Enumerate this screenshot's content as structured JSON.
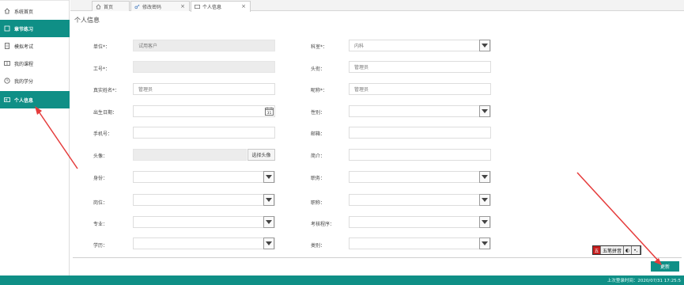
{
  "sidebar": {
    "items": [
      {
        "label": "系统首页",
        "active": false
      },
      {
        "label": "章节练习",
        "active": true
      },
      {
        "label": "模拟考试",
        "active": false
      },
      {
        "label": "我的课程",
        "active": false
      },
      {
        "label": "我的学分",
        "active": false
      },
      {
        "label": "个人信息",
        "active": true
      }
    ]
  },
  "tabs": [
    {
      "label": "首页"
    },
    {
      "label": "修改密码"
    },
    {
      "label": "个人信息"
    }
  ],
  "page": {
    "title": "个人信息"
  },
  "form": {
    "unit": {
      "label": "单位*：",
      "value": "试用客户"
    },
    "department": {
      "label": "科室*：",
      "value": "内科"
    },
    "emp_no": {
      "label": "工号*：",
      "value": ""
    },
    "title": {
      "label": "头衔：",
      "value": "管理员"
    },
    "real_name": {
      "label": "真实姓名*：",
      "value": "管理员"
    },
    "nickname": {
      "label": "昵称*：",
      "value": "管理员"
    },
    "birth": {
      "label": "出生日期：",
      "value": ""
    },
    "gender": {
      "label": "性别：",
      "value": ""
    },
    "phone": {
      "label": "手机号：",
      "value": ""
    },
    "email": {
      "label": "邮箱：",
      "value": ""
    },
    "avatar": {
      "label": "头像：",
      "value": "",
      "button": "选择头像"
    },
    "intro": {
      "label": "简介：",
      "value": ""
    },
    "identity": {
      "label": "身份：",
      "value": ""
    },
    "position": {
      "label": "职务：",
      "value": ""
    },
    "post": {
      "label": "岗位：",
      "value": ""
    },
    "prof_title": {
      "label": "职称：",
      "value": ""
    },
    "major": {
      "label": "专业：",
      "value": ""
    },
    "exam_program": {
      "label": "考核程序：",
      "value": ""
    },
    "education": {
      "label": "学历：",
      "value": ""
    },
    "category": {
      "label": "类别：",
      "value": ""
    }
  },
  "ime": {
    "name": "五笔拼音",
    "moon": "◐",
    "punct": "•,"
  },
  "actions": {
    "update": "更新"
  },
  "status": {
    "text": "上次登录时间：2020/07/31 17:25:5"
  },
  "colors": {
    "accent": "#0f8f86",
    "arrow": "#e53b3b"
  },
  "icons": {
    "calendar_day": "31"
  }
}
